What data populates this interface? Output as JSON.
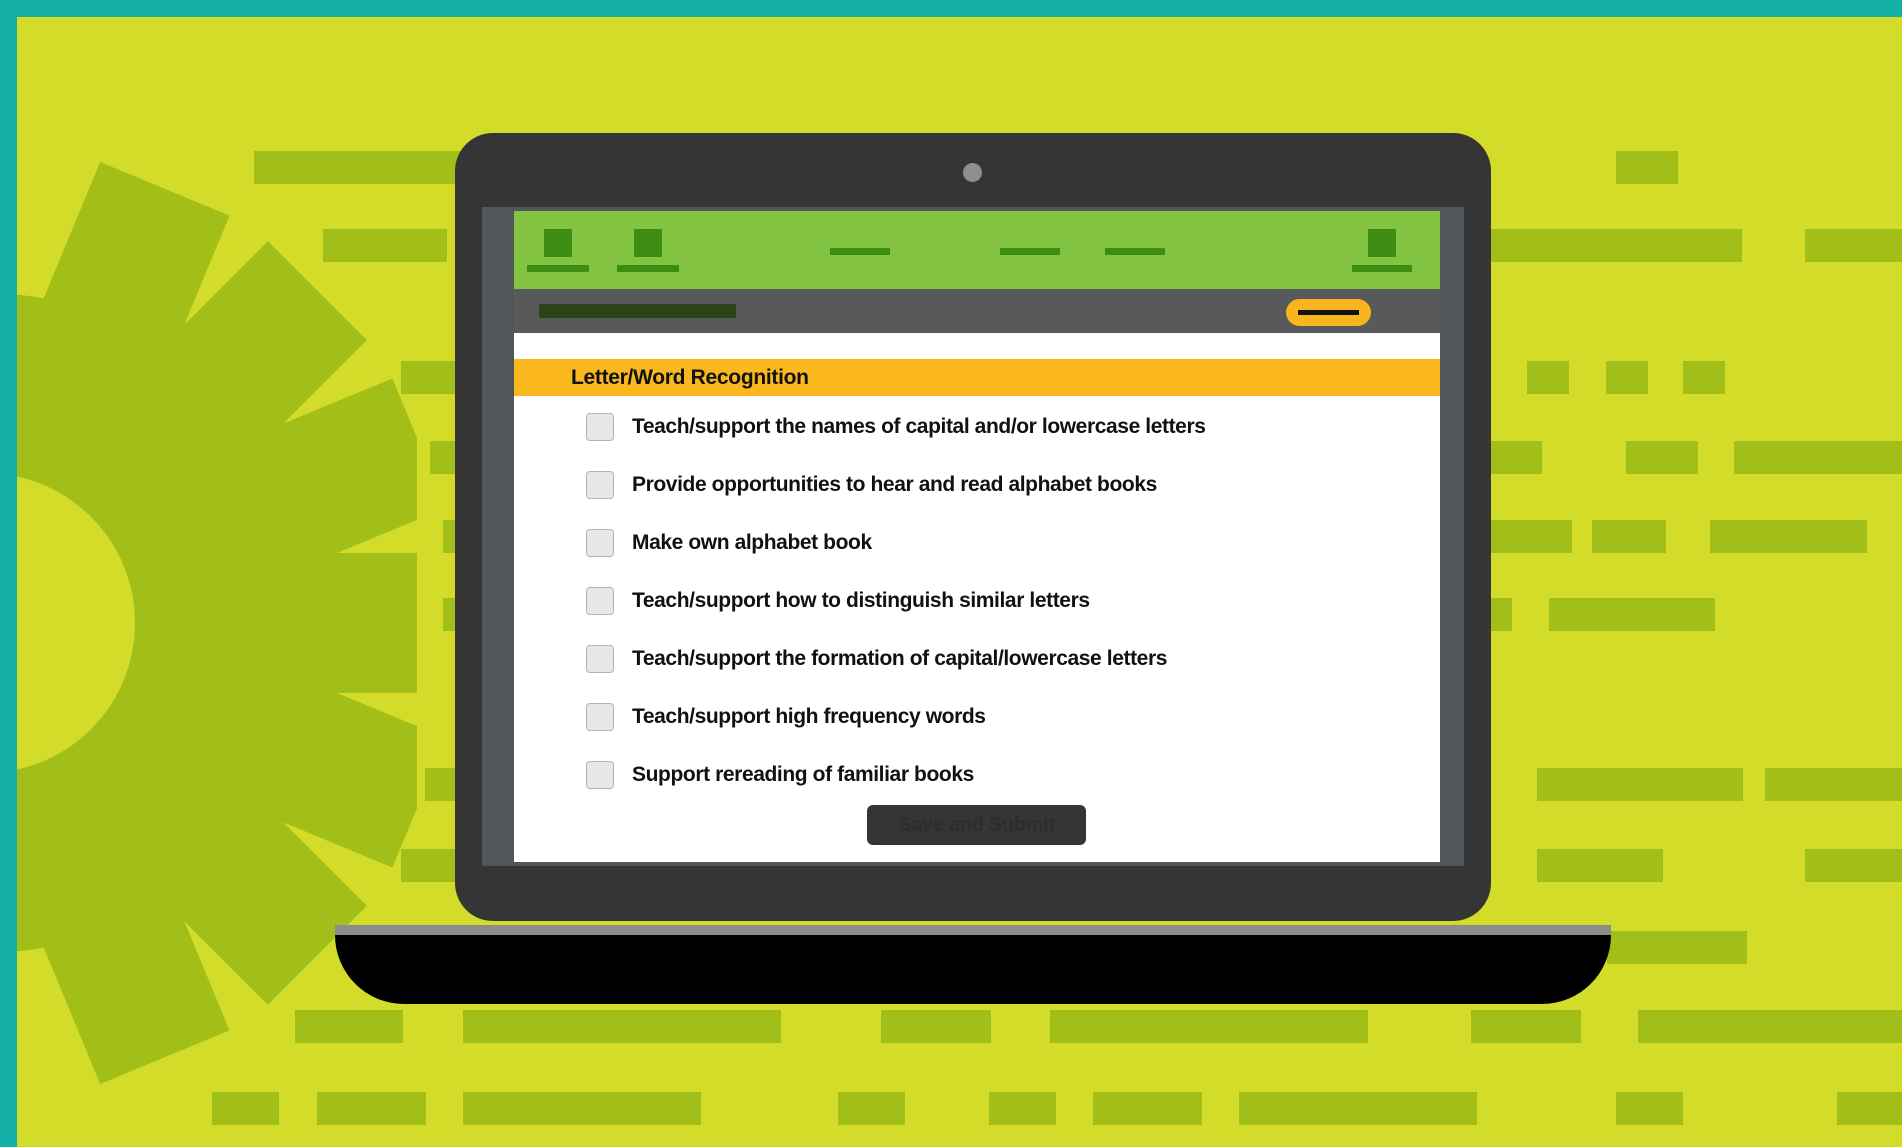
{
  "colors": {
    "border": "#14afa5",
    "background": "#d3dc28",
    "accent_green": "#82c341",
    "dark_green": "#3e8d13",
    "orange": "#fbb81e",
    "laptop": "#353535"
  },
  "icons": {
    "gear": "gear-icon",
    "camera": "camera-icon"
  },
  "section": {
    "title": "Letter/Word Recognition"
  },
  "checklist": [
    {
      "label": "Teach/support the names of capital and/or lowercase letters",
      "checked": false
    },
    {
      "label": "Provide opportunities to hear and read alphabet books",
      "checked": false
    },
    {
      "label": "Make own alphabet book",
      "checked": false
    },
    {
      "label": "Teach/support how to distinguish similar letters",
      "checked": false
    },
    {
      "label": "Teach/support the formation of capital/lowercase letters",
      "checked": false
    },
    {
      "label": "Teach/support high frequency words",
      "checked": false
    },
    {
      "label": "Support rereading of familiar books",
      "checked": false
    }
  ],
  "actions": {
    "submit_label": "Save and Submit"
  }
}
